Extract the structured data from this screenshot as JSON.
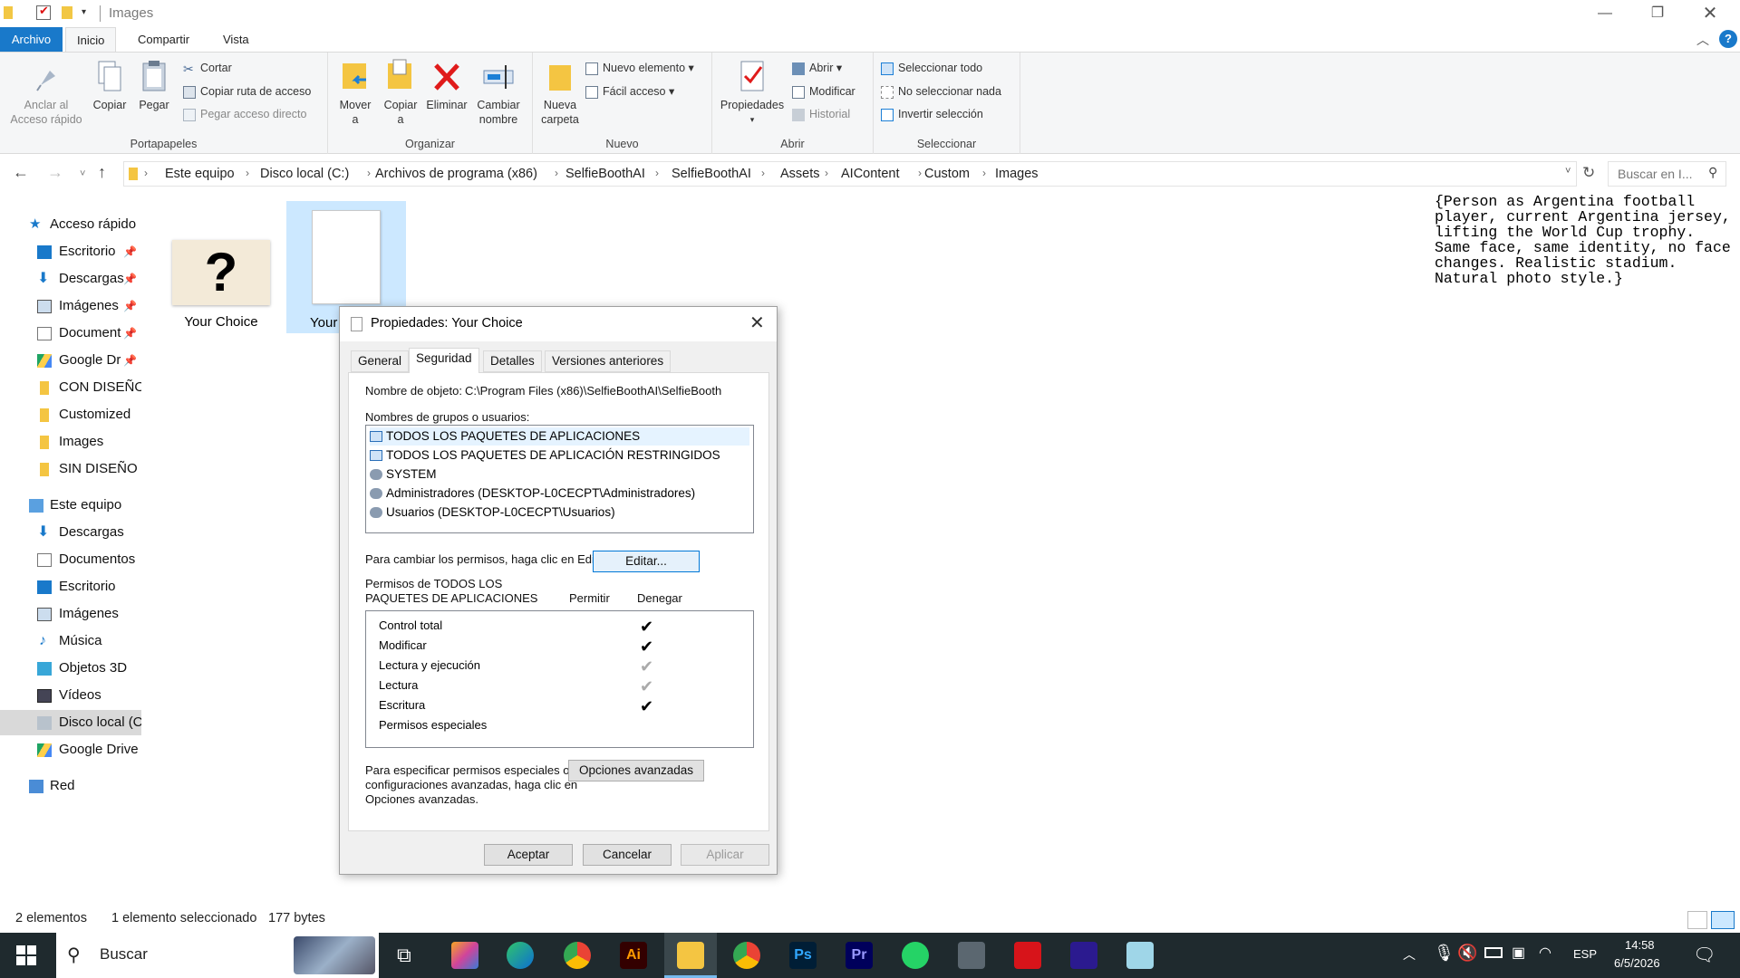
{
  "window": {
    "title": "Images"
  },
  "ribbon_tabs": [
    "Archivo",
    "Inicio",
    "Compartir",
    "Vista"
  ],
  "ribbon": {
    "clipboard": {
      "group": "Portapapeles",
      "pin_line1": "Anclar al",
      "pin_line2": "Acceso rápido",
      "copy": "Copiar",
      "paste": "Pegar",
      "cut": "Cortar",
      "copy_path": "Copiar ruta de acceso",
      "paste_shortcut": "Pegar acceso directo"
    },
    "organize": {
      "group": "Organizar",
      "move_line1": "Mover",
      "move_line2": "a",
      "copyto_line1": "Copiar",
      "copyto_line2": "a",
      "delete": "Eliminar",
      "rename_line1": "Cambiar",
      "rename_line2": "nombre"
    },
    "new": {
      "group": "Nuevo",
      "folder_line1": "Nueva",
      "folder_line2": "carpeta",
      "new_item": "Nuevo elemento",
      "easy_access": "Fácil acceso"
    },
    "open": {
      "group": "Abrir",
      "properties": "Propiedades",
      "open": "Abrir",
      "edit": "Modificar",
      "history": "Historial"
    },
    "select": {
      "group": "Seleccionar",
      "all": "Seleccionar todo",
      "none": "No seleccionar nada",
      "invert": "Invertir selección"
    }
  },
  "breadcrumb": [
    "Este equipo",
    "Disco local (C:)",
    "Archivos de programa (x86)",
    "SelfieBoothAI",
    "SelfieBoothAI",
    "Assets",
    "AIContent",
    "Custom",
    "Images"
  ],
  "search_placeholder": "Buscar en I...",
  "nav": {
    "quick_access": "Acceso rápido",
    "quick_items": [
      "Escritorio",
      "Descargas",
      "Imágenes",
      "Document",
      "Google Dr",
      "CON DISEÑO",
      "Customized",
      "Images",
      "SIN DISEÑO"
    ],
    "this_pc": "Este equipo",
    "pc_items": [
      "Descargas",
      "Documentos",
      "Escritorio",
      "Imágenes",
      "Música",
      "Objetos 3D",
      "Vídeos",
      "Disco local (C",
      "Google Drive"
    ],
    "network": "Red"
  },
  "files": [
    {
      "name": "Your Choice",
      "type": "image",
      "icon_glyph": "?"
    },
    {
      "name": "Your",
      "type": "document"
    }
  ],
  "note_text": "{Person as Argentina football\nplayer, current Argentina jersey,\nlifting the World Cup trophy.\nSame face, same identity, no face\nchanges. Realistic stadium.\nNatural photo style.}",
  "status": {
    "count": "2 elementos",
    "selected": "1 elemento seleccionado",
    "size": "177 bytes"
  },
  "dialog": {
    "title": "Propiedades: Your Choice",
    "tabs": [
      "General",
      "Seguridad",
      "Detalles",
      "Versiones anteriores"
    ],
    "object_label": "Nombre de objeto:",
    "object_value": "C:\\Program Files (x86)\\SelfieBoothAI\\SelfieBooth",
    "groups_label": "Nombres de grupos o usuarios:",
    "groups": [
      "TODOS LOS PAQUETES DE APLICACIONES",
      "TODOS LOS PAQUETES DE APLICACIÓN RESTRINGIDOS",
      "SYSTEM",
      "Administradores (DESKTOP-L0CECPT\\Administradores)",
      "Usuarios (DESKTOP-L0CECPT\\Usuarios)"
    ],
    "change_text": "Para cambiar los permisos, haga clic en Editar.",
    "edit_button": "Editar...",
    "perm_title_line1": "Permisos de TODOS LOS",
    "perm_title_line2": "PAQUETES DE APLICACIONES",
    "allow": "Permitir",
    "deny": "Denegar",
    "permissions": [
      {
        "name": "Control total",
        "allow": "✔",
        "state": "checked"
      },
      {
        "name": "Modificar",
        "allow": "✔",
        "state": "checked"
      },
      {
        "name": "Lectura y ejecución",
        "allow": "✔",
        "state": "inherited"
      },
      {
        "name": "Lectura",
        "allow": "✔",
        "state": "inherited"
      },
      {
        "name": "Escritura",
        "allow": "✔",
        "state": "checked"
      },
      {
        "name": "Permisos especiales",
        "allow": "",
        "state": "none"
      }
    ],
    "advanced_text_1": "Para especificar permisos especiales o",
    "advanced_text_2": "configuraciones avanzadas, haga clic en",
    "advanced_text_3": "Opciones avanzadas.",
    "advanced_button": "Opciones avanzadas",
    "ok": "Aceptar",
    "cancel": "Cancelar",
    "apply": "Aplicar"
  },
  "taskbar": {
    "search": "Buscar",
    "lang": "ESP",
    "time": "14:58",
    "date": "6/5/2026"
  }
}
